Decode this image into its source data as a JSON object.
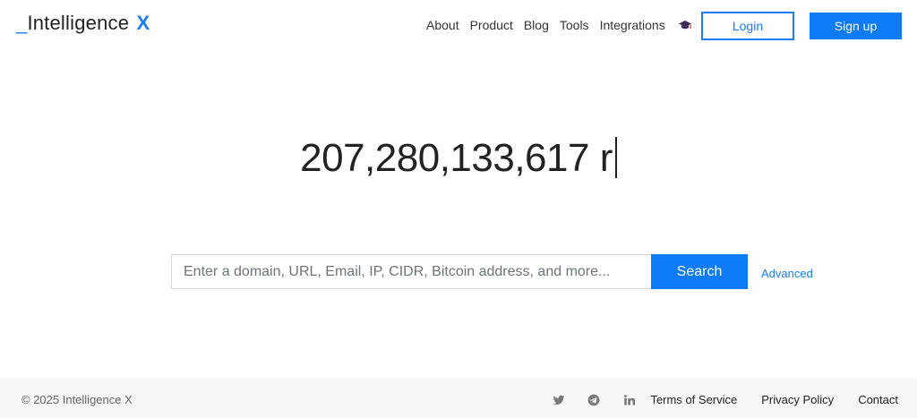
{
  "header": {
    "logo_prefix": "_",
    "logo_text": "Intelligence",
    "logo_suffix": "X",
    "nav": [
      "About",
      "Product",
      "Blog",
      "Tools",
      "Integrations"
    ],
    "academy_icon": "graduation-cap-icon",
    "login_label": "Login",
    "signup_label": "Sign up"
  },
  "hero": {
    "counter_text": "207,280,133,617 r"
  },
  "search": {
    "placeholder": "Enter a domain, URL, Email, IP, CIDR, Bitcoin address, and more...",
    "button_label": "Search",
    "advanced_label": "Advanced"
  },
  "footer": {
    "copyright": "© 2025 Intelligence X",
    "social_icons": [
      "twitter-icon",
      "telegram-icon",
      "linkedin-icon"
    ],
    "links": [
      "Terms of Service",
      "Privacy Policy",
      "Contact"
    ]
  },
  "colors": {
    "accent": "#0d7bf5",
    "footer_bg": "#f7f7f7"
  }
}
